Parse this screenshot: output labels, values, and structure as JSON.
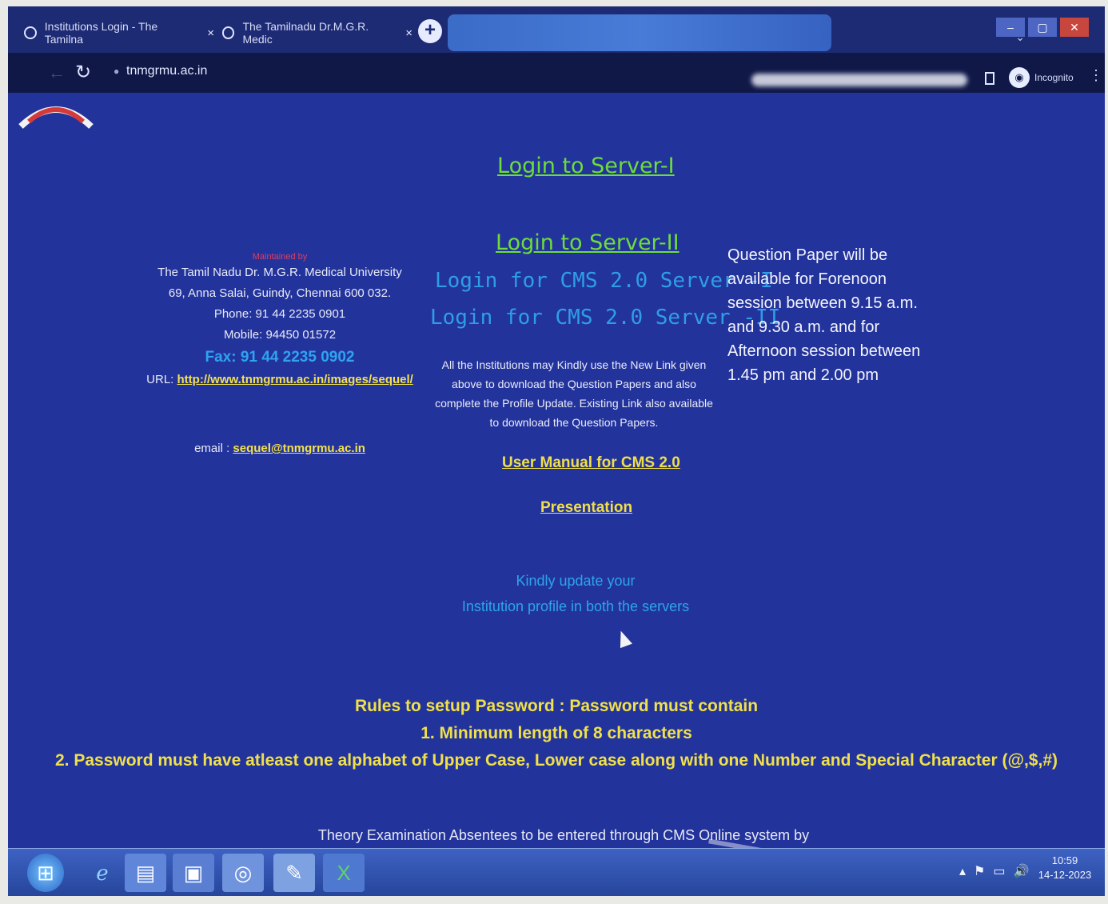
{
  "browser": {
    "tabs": [
      {
        "title": "Institutions Login - The Tamilna",
        "close": "×"
      },
      {
        "title": "The Tamilnadu Dr.M.G.R. Medic",
        "close": "×"
      }
    ],
    "new_tab": "+",
    "address_url": "tnmgrmu.ac.in",
    "incognito_label": "Incognito"
  },
  "page": {
    "links": {
      "server1": "Login to Server-I",
      "server2": "Login to Server-II",
      "cms1": "Login for CMS 2.0 Server -I",
      "cms2": "Login for CMS 2.0 Server -II",
      "user_manual": "User Manual for CMS 2.0",
      "presentation": "Presentation"
    },
    "contact": {
      "maintained_by": "Maintained by",
      "university": "The Tamil Nadu Dr. M.G.R. Medical University",
      "address": "69, Anna Salai, Guindy, Chennai 600 032.",
      "phone": "Phone: 91 44 2235 0901",
      "mobile": "Mobile: 94450 01572",
      "fax": "Fax: 91 44 2235 0902",
      "url_label": "URL:",
      "url": "http://www.tnmgrmu.ac.in/images/sequel/",
      "email_label": "email :",
      "email": "sequel@tnmgrmu.ac.in"
    },
    "info_text": "All the Institutions may Kindly use the New Link given above to download the Question Papers and also complete the Profile Update. Existing Link also available to download the Question Papers.",
    "question_paper_note": "Question Paper will be available for Forenoon session between 9.15 a.m. and 9.30 a.m. and for Afternoon session between 1.45 pm and 2.00 pm",
    "kindly_update": [
      "Kindly update your",
      "Institution profile in both the servers"
    ],
    "rules": {
      "heading": "Rules to setup Password : Password must contain",
      "rule1": "1. Minimum length of 8 characters",
      "rule2": "2. Password must have atleast one alphabet of Upper Case, Lower case along with one Number and Special Character (@,$,#)"
    },
    "theory_note": "Theory Examination Absentees to be entered through CMS Online system by"
  },
  "taskbar": {
    "time": "10:59",
    "date": "14-12-2023"
  },
  "colors": {
    "page_bg": "#23339c",
    "green_link": "#6ddc3a",
    "blue_link": "#2f9ee6",
    "yellow": "#f0df4a"
  }
}
